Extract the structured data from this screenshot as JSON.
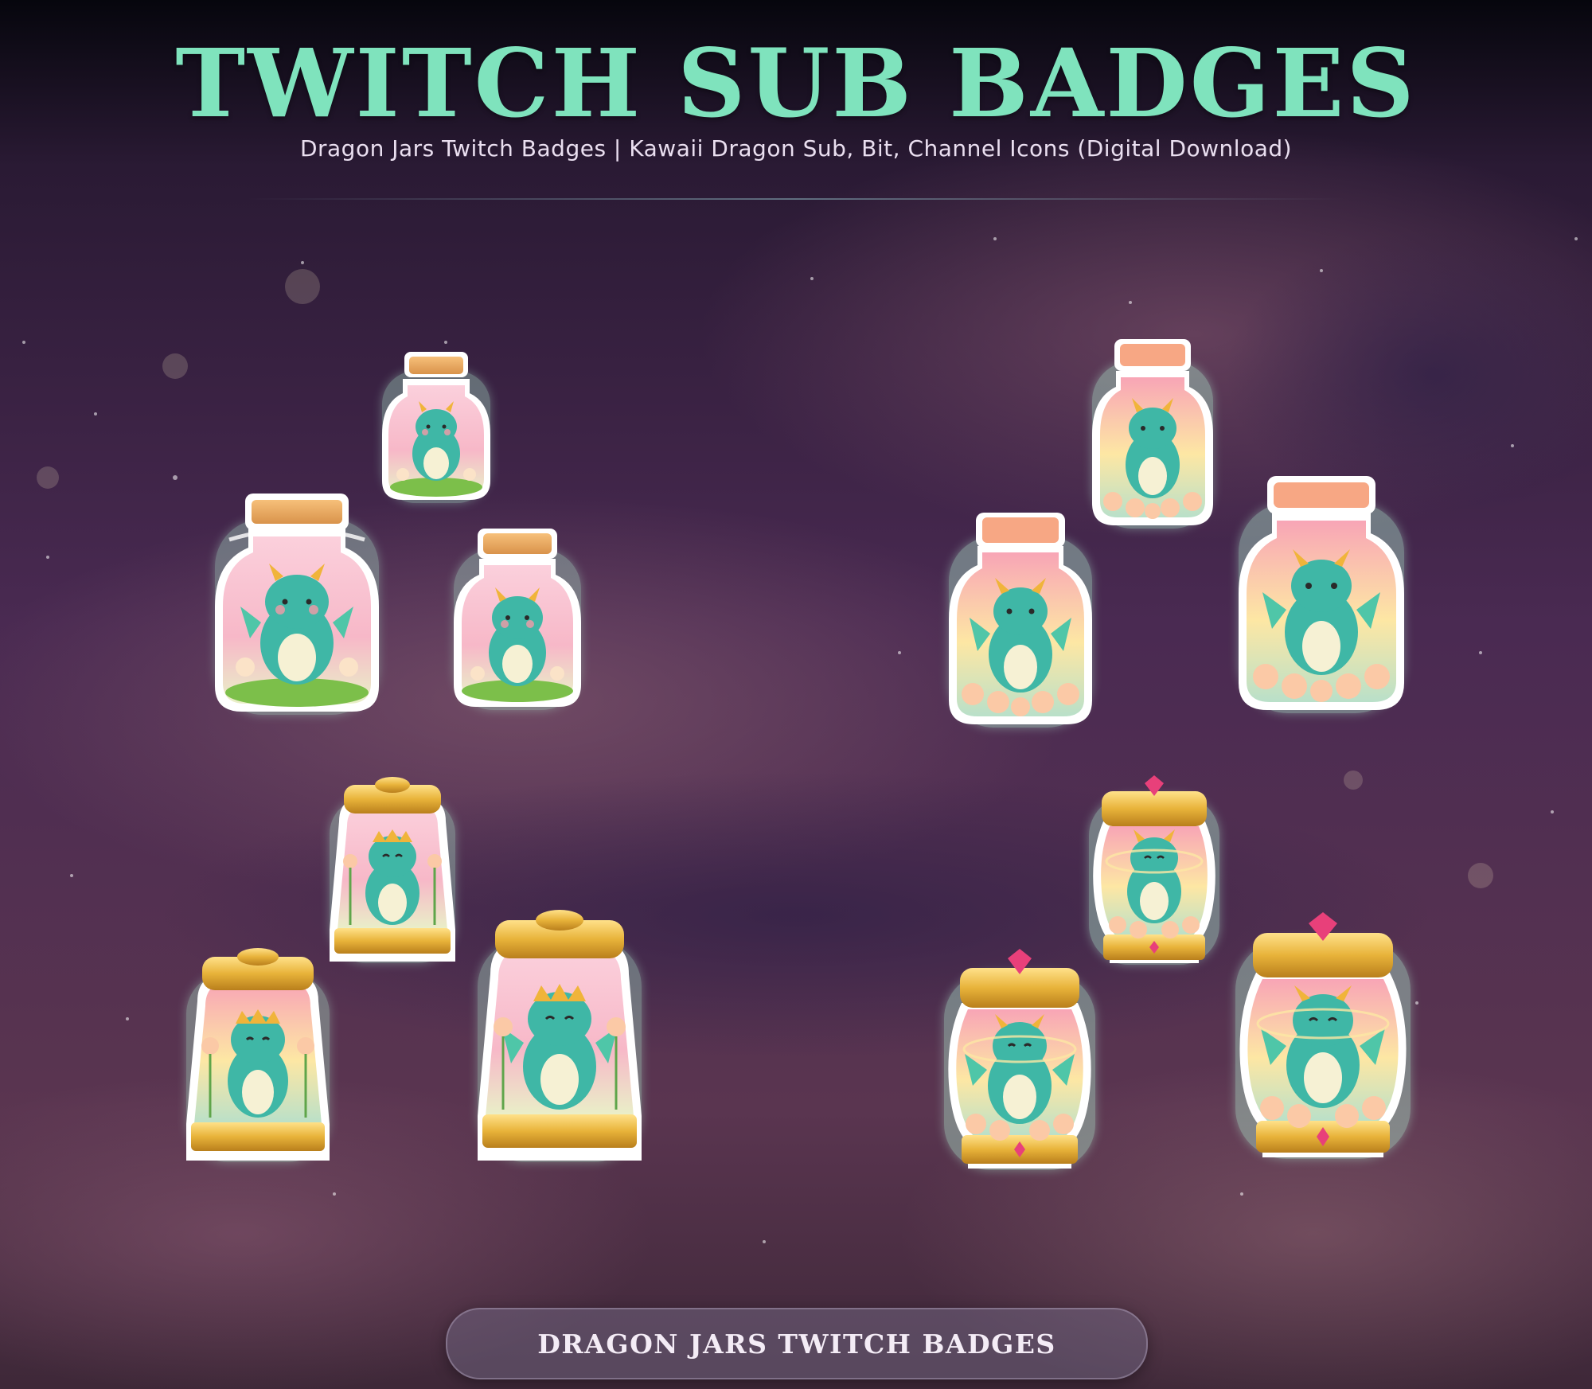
{
  "header": {
    "title": "TWITCH SUB BADGES",
    "subtitle": "Dragon Jars Twitch Badges | Kawaii Dragon Sub, Bit, Channel Icons (Digital Download)"
  },
  "footer": {
    "label": "DRAGON JARS TWITCH BADGES"
  },
  "colors": {
    "title": "#7fe3bd",
    "background": "#3a2544",
    "dragon": "#3fb7a6",
    "glow": "#b5f5d5",
    "cork": "#f2b470",
    "gold": "#e8b33a",
    "gem": "#e8407a"
  },
  "badge_groups": [
    {
      "name": "cork-jars-grass",
      "count": 3
    },
    {
      "name": "cork-jars-lotus",
      "count": 3
    },
    {
      "name": "gold-lid-jars",
      "count": 3
    },
    {
      "name": "gem-gold-jars",
      "count": 3
    }
  ]
}
